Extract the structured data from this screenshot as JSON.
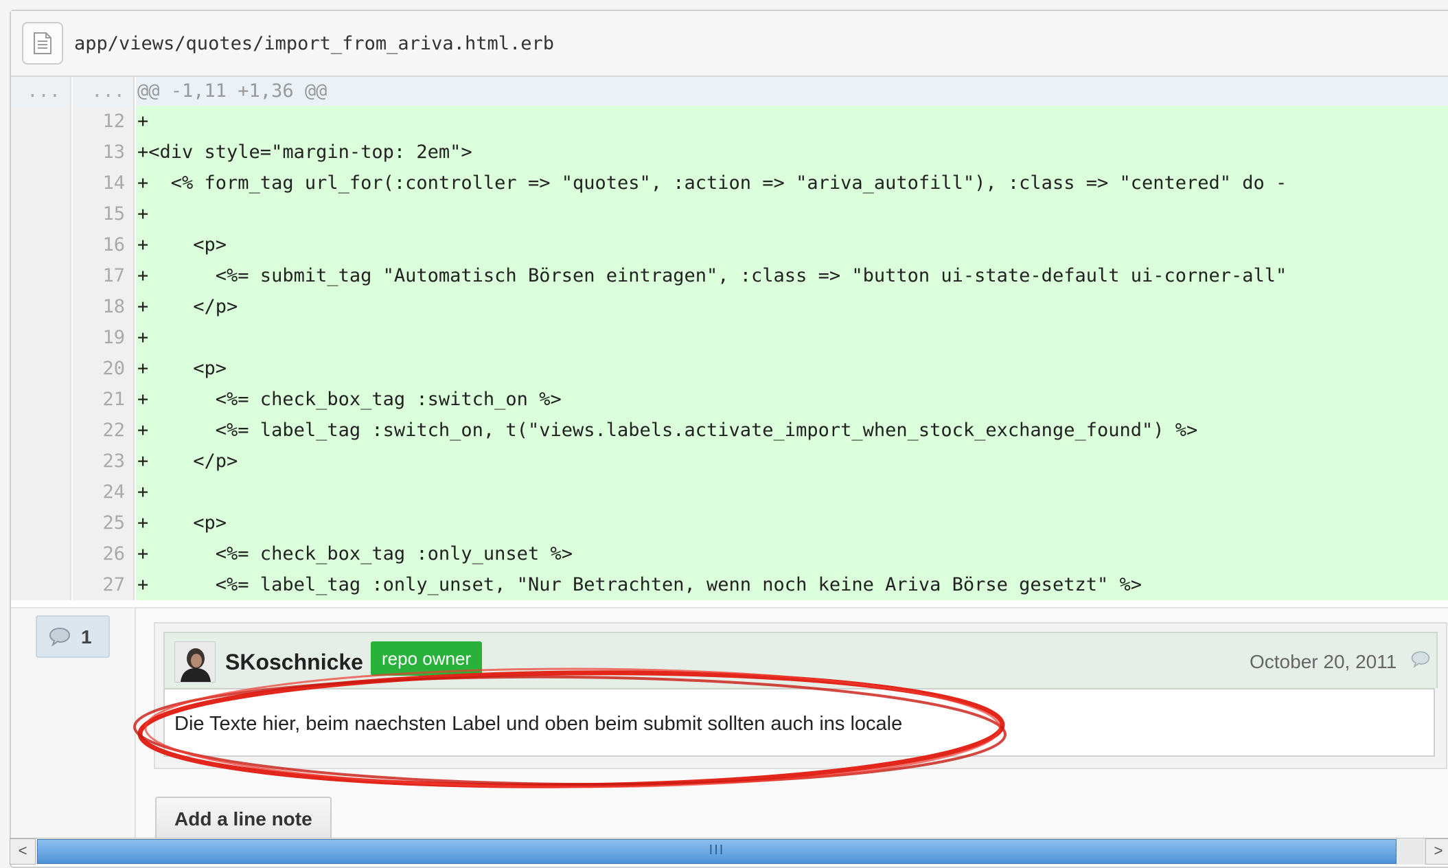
{
  "file": {
    "path": "app/views/quotes/import_from_ariva.html.erb",
    "icon": "file-text-icon"
  },
  "diff": {
    "hunk": {
      "old_num": "...",
      "new_num": "...",
      "header": "@@ -1,11 +1,36 @@"
    },
    "lines": [
      {
        "num": "12",
        "code": "+"
      },
      {
        "num": "13",
        "code": "+<div style=\"margin-top: 2em\">"
      },
      {
        "num": "14",
        "code": "+  <% form_tag url_for(:controller => \"quotes\", :action => \"ariva_autofill\"), :class => \"centered\" do -"
      },
      {
        "num": "15",
        "code": "+"
      },
      {
        "num": "16",
        "code": "+    <p>"
      },
      {
        "num": "17",
        "code": "+      <%= submit_tag \"Automatisch Börsen eintragen\", :class => \"button ui-state-default ui-corner-all\""
      },
      {
        "num": "18",
        "code": "+    </p>"
      },
      {
        "num": "19",
        "code": "+"
      },
      {
        "num": "20",
        "code": "+    <p>"
      },
      {
        "num": "21",
        "code": "+      <%= check_box_tag :switch_on %>"
      },
      {
        "num": "22",
        "code": "+      <%= label_tag :switch_on, t(\"views.labels.activate_import_when_stock_exchange_found\") %>"
      },
      {
        "num": "23",
        "code": "+    </p>"
      },
      {
        "num": "24",
        "code": "+"
      },
      {
        "num": "25",
        "code": "+    <p>"
      },
      {
        "num": "26",
        "code": "+      <%= check_box_tag :only_unset %>"
      },
      {
        "num": "27",
        "code": "+      <%= label_tag :only_unset, \"Nur Betrachten, wenn noch keine Ariva Börse gesetzt\" %>"
      }
    ]
  },
  "notes": {
    "count": "1",
    "comment": {
      "author": "SKoschnicke",
      "badge": "repo owner",
      "date": "October 20, 2011",
      "text": "Die Texte hier, beim naechsten Label und oben beim submit sollten auch ins locale"
    },
    "add_button": "Add a line note"
  },
  "scrollbar": {
    "grip": "III",
    "left_arrow": "<",
    "right_arrow": ">"
  },
  "colors": {
    "added_line_bg": "#dbffdb",
    "hunk_bg": "#eaf2f8",
    "badge_bg": "#29b23b",
    "highlight_ring": "#e3261c",
    "scroll_thumb": "#4e93d6"
  }
}
